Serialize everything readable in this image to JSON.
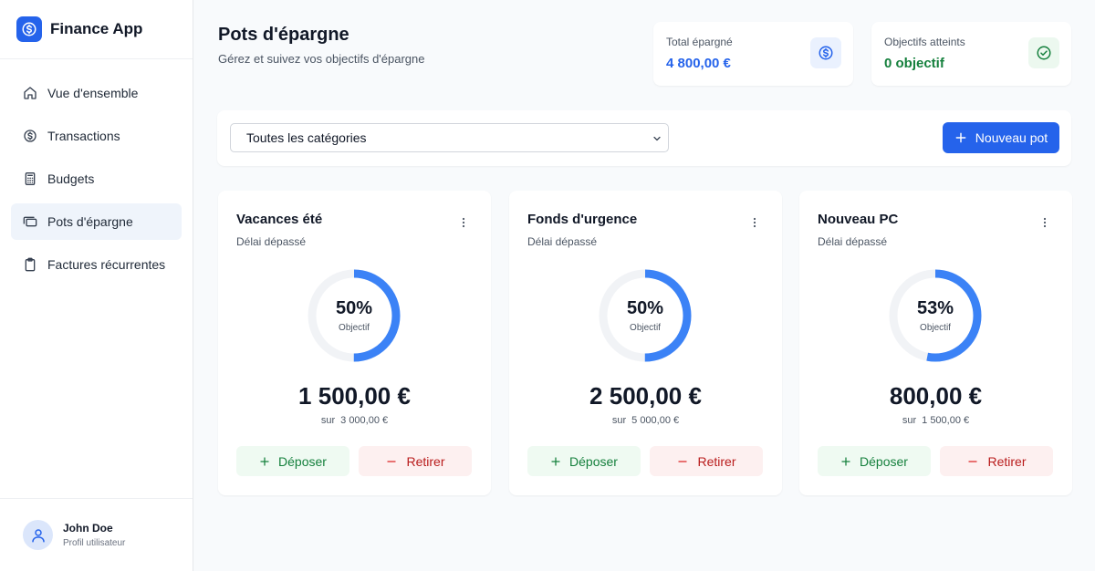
{
  "app": {
    "title": "Finance App",
    "logo_icon": "dollar-icon",
    "accent_color": "#2563eb"
  },
  "sidebar": {
    "items": [
      {
        "label": "Vue d'ensemble",
        "icon": "home-icon",
        "active": false
      },
      {
        "label": "Transactions",
        "icon": "dollar-circle-icon",
        "active": false
      },
      {
        "label": "Budgets",
        "icon": "calculator-icon",
        "active": false
      },
      {
        "label": "Pots d'épargne",
        "icon": "wallet-icon",
        "active": true
      },
      {
        "label": "Factures récurrentes",
        "icon": "clipboard-icon",
        "active": false
      }
    ]
  },
  "user": {
    "name": "John Doe",
    "role": "Profil utilisateur"
  },
  "header": {
    "title": "Pots d'épargne",
    "subtitle": "Gérez et suivez vos objectifs d'épargne"
  },
  "stats": [
    {
      "label": "Total épargné",
      "value": "4 800,00 €",
      "color": "#2563eb",
      "icon": "dollar-circle-icon"
    },
    {
      "label": "Objectifs atteints",
      "value": "0 objectif",
      "color": "#15803d",
      "icon": "check-circle-icon"
    }
  ],
  "filter": {
    "category_value": "Toutes les catégories",
    "new_button_label": "Nouveau pot"
  },
  "pots": [
    {
      "name": "Vacances été",
      "status": "Délai dépassé",
      "percent": 50,
      "percent_label": "50%",
      "progress_label": "Objectif",
      "amount": "1 500,00 €",
      "target_prefix": "sur",
      "target": "3 000,00 €",
      "deposit_label": "Déposer",
      "withdraw_label": "Retirer"
    },
    {
      "name": "Fonds d'urgence",
      "status": "Délai dépassé",
      "percent": 50,
      "percent_label": "50%",
      "progress_label": "Objectif",
      "amount": "2 500,00 €",
      "target_prefix": "sur",
      "target": "5 000,00 €",
      "deposit_label": "Déposer",
      "withdraw_label": "Retirer"
    },
    {
      "name": "Nouveau PC",
      "status": "Délai dépassé",
      "percent": 53,
      "percent_label": "53%",
      "progress_label": "Objectif",
      "amount": "800,00 €",
      "target_prefix": "sur",
      "target": "1 500,00 €",
      "deposit_label": "Déposer",
      "withdraw_label": "Retirer"
    }
  ]
}
